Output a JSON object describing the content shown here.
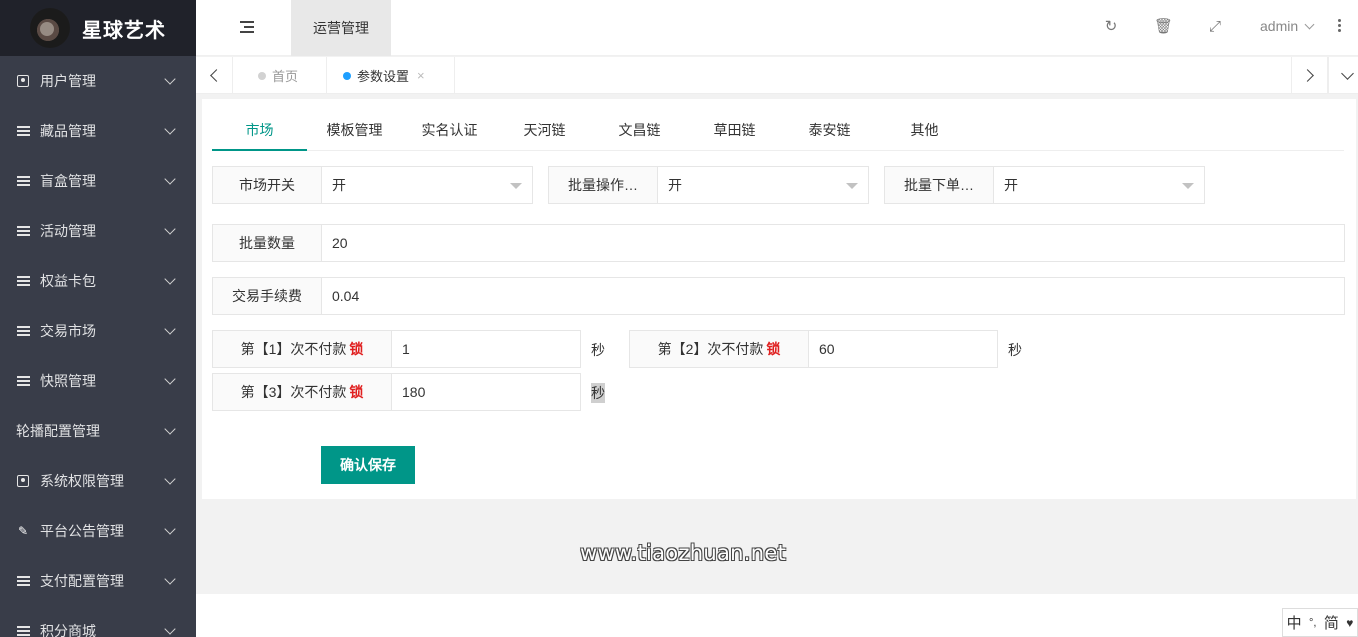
{
  "brand": {
    "title": "星球艺术"
  },
  "sidebar": {
    "items": [
      {
        "label": "用户管理",
        "icon": "contact-card-icon"
      },
      {
        "label": "藏品管理",
        "icon": "list-icon"
      },
      {
        "label": "盲盒管理",
        "icon": "list-icon"
      },
      {
        "label": "活动管理",
        "icon": "list-icon"
      },
      {
        "label": "权益卡包",
        "icon": "list-icon"
      },
      {
        "label": "交易市场",
        "icon": "list-icon"
      },
      {
        "label": "快照管理",
        "icon": "list-icon"
      },
      {
        "label": "轮播配置管理",
        "icon": "none"
      },
      {
        "label": "系统权限管理",
        "icon": "contact-card-icon"
      },
      {
        "label": "平台公告管理",
        "icon": "edit-icon"
      },
      {
        "label": "支付配置管理",
        "icon": "list-icon"
      },
      {
        "label": "积分商城",
        "icon": "list-icon"
      }
    ]
  },
  "header": {
    "active_tab": "运营管理",
    "user": "admin"
  },
  "tabsbar": {
    "tabs": [
      {
        "label": "首页",
        "close": ""
      },
      {
        "label": "参数设置",
        "close": "×"
      }
    ]
  },
  "settings": {
    "sub_tabs": [
      "市场",
      "模板管理",
      "实名认证",
      "天河链",
      "文昌链",
      "草田链",
      "泰安链",
      "其他"
    ],
    "market_switch": {
      "label": "市场开关",
      "value": "开"
    },
    "batch_op": {
      "label": "批量操作…",
      "value": "开"
    },
    "batch_order": {
      "label": "批量下单…",
      "value": "开"
    },
    "batch_qty": {
      "label": "批量数量",
      "value": "20"
    },
    "fee": {
      "label": "交易手续费",
      "value": "0.04"
    },
    "lock1": {
      "label": "第【1】次不付款",
      "lock": "锁",
      "value": "1",
      "unit": "秒"
    },
    "lock2": {
      "label": "第【2】次不付款",
      "lock": "锁",
      "value": "60",
      "unit": "秒"
    },
    "lock3": {
      "label": "第【3】次不付款",
      "lock": "锁",
      "value": "180",
      "unit": "秒"
    },
    "save_label": "确认保存"
  },
  "watermark": "www.tiaozhuan.net",
  "ime": {
    "a": "中",
    "b": "°,",
    "c": "简"
  },
  "colors": {
    "accent": "#009688",
    "sidebar": "#393d49",
    "brand_bg": "#20222a",
    "lock": "#e02020"
  }
}
